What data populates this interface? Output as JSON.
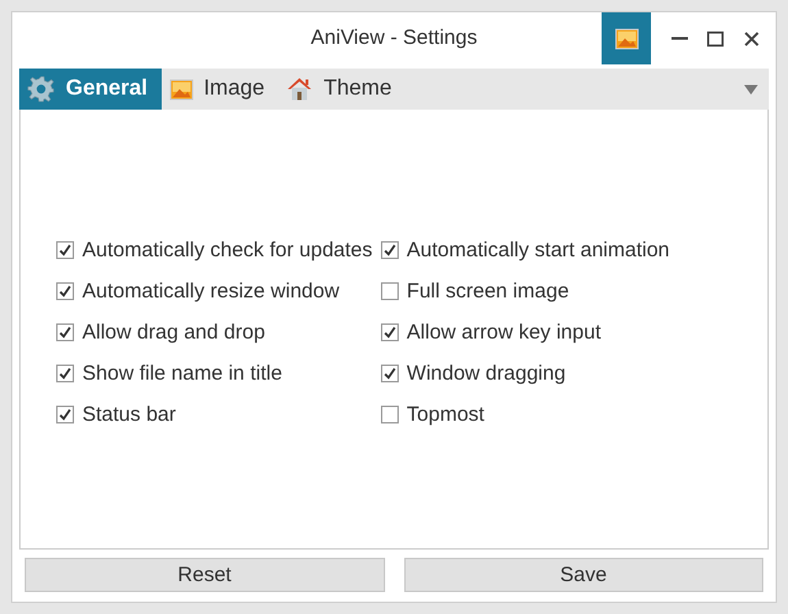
{
  "window": {
    "title": "AniView - Settings"
  },
  "tabs": [
    {
      "label": "General",
      "kind": "gear",
      "selected": true
    },
    {
      "label": "Image",
      "kind": "image",
      "selected": false
    },
    {
      "label": "Theme",
      "kind": "house",
      "selected": false
    }
  ],
  "options": [
    [
      {
        "label": "Automatically check for updates",
        "checked": true
      },
      {
        "label": "Automatically resize window",
        "checked": true
      },
      {
        "label": "Allow drag and drop",
        "checked": true
      },
      {
        "label": "Show file name in title",
        "checked": true
      },
      {
        "label": "Status bar",
        "checked": true
      }
    ],
    [
      {
        "label": "Automatically start animation",
        "checked": true
      },
      {
        "label": "Full screen image",
        "checked": false
      },
      {
        "label": "Allow arrow key input",
        "checked": true
      },
      {
        "label": "Window dragging",
        "checked": true
      },
      {
        "label": "Topmost",
        "checked": false
      }
    ]
  ],
  "buttons": [
    "Reset",
    "Save"
  ]
}
